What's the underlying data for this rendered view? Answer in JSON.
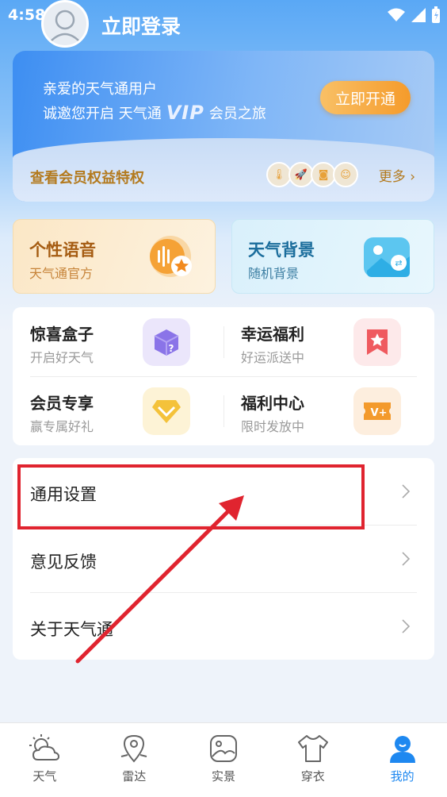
{
  "status_bar": {
    "time": "4:58"
  },
  "header": {
    "login_label": "立即登录"
  },
  "vip_card": {
    "greeting": "亲爱的天气通用户",
    "invite_prefix": "诚邀您开启 天气通",
    "vip_badge": "VIP",
    "invite_suffix": "会员之旅",
    "open_button": "立即开通",
    "benefits_link": "查看会员权益特权",
    "more_link": "更多",
    "accent_color": "#f59b2b"
  },
  "features": [
    {
      "title": "个性语音",
      "subtitle": "天气通官方",
      "icon": "voice-wave-icon"
    },
    {
      "title": "天气背景",
      "subtitle": "随机背景",
      "icon": "image-icon"
    }
  ],
  "grid": [
    {
      "title": "惊喜盒子",
      "subtitle": "开启好天气",
      "icon": "mystery-box-icon",
      "icon_bg": "#ebe6fb"
    },
    {
      "title": "幸运福利",
      "subtitle": "好运派送中",
      "icon": "star-bookmark-icon",
      "icon_bg": "#fde9ea"
    },
    {
      "title": "会员专享",
      "subtitle": "赢专属好礼",
      "icon": "diamond-icon",
      "icon_bg": "#fdf3d6"
    },
    {
      "title": "福利中心",
      "subtitle": "限时发放中",
      "icon": "ticket-icon",
      "icon_bg": "#fdeede"
    }
  ],
  "settings_list": [
    {
      "label": "通用设置"
    },
    {
      "label": "意见反馈"
    },
    {
      "label": "关于天气通"
    }
  ],
  "tabs": [
    {
      "label": "天气",
      "icon": "weather-icon",
      "active": false
    },
    {
      "label": "雷达",
      "icon": "location-pin-icon",
      "active": false
    },
    {
      "label": "实景",
      "icon": "photo-icon",
      "active": false
    },
    {
      "label": "穿衣",
      "icon": "shirt-icon",
      "active": false
    },
    {
      "label": "我的",
      "icon": "profile-icon",
      "active": true
    }
  ],
  "annotation_color": "#e0242f"
}
